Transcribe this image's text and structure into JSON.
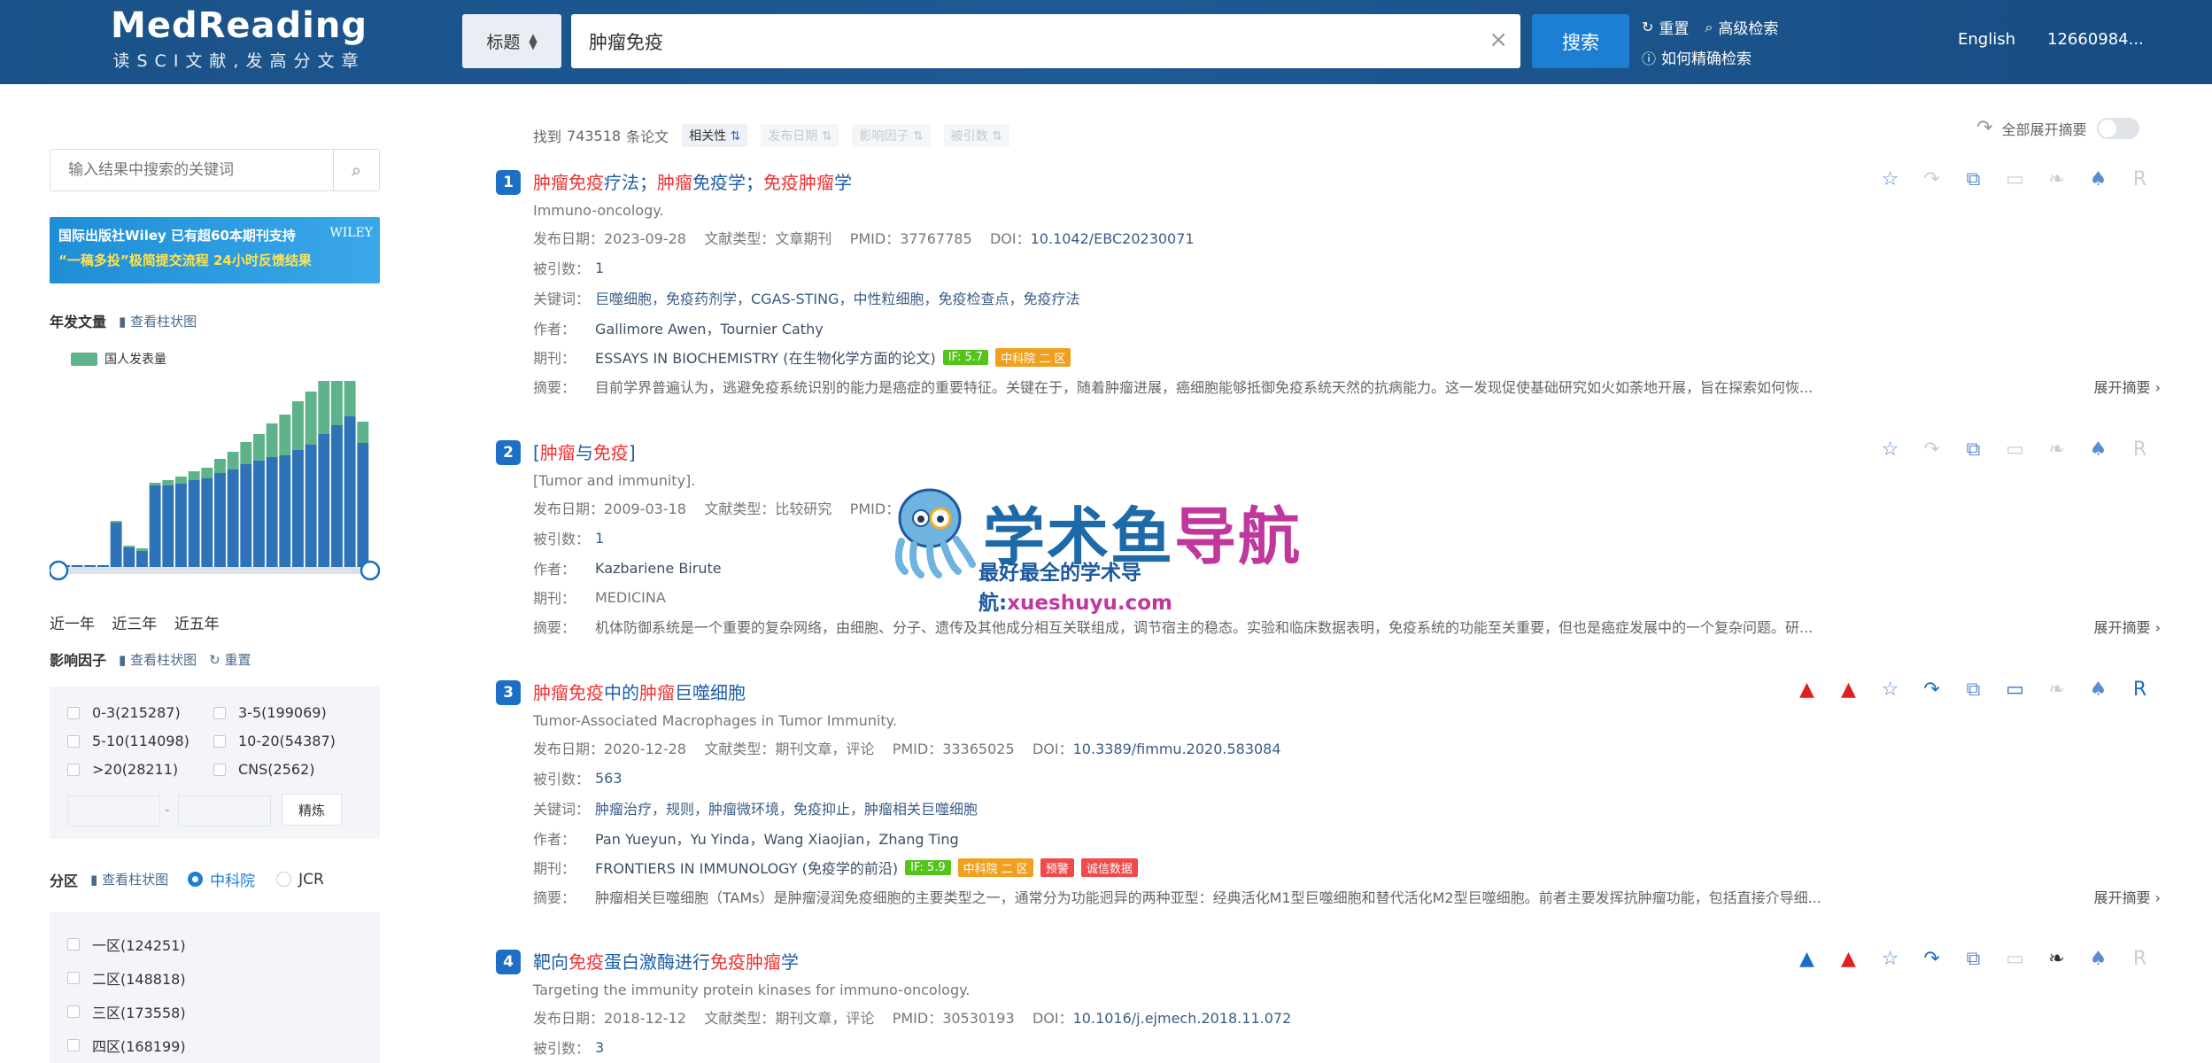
{
  "header": {
    "logo_title": "MedReading",
    "logo_sub": "读SCI文献,发高分文章",
    "field_select": "标题",
    "query": "肿瘤免疫",
    "search_label": "搜索",
    "reset_label": "重置",
    "advanced_label": "高级检索",
    "howto_label": "如何精确检索",
    "lang_label": "English",
    "user_label": "12660984..."
  },
  "sidebar": {
    "search_placeholder": "输入结果中搜索的关键词",
    "banner_line1": "国际出版社Wiley 已有超60本期刊支持",
    "banner_line2": "“一稿多投”极简提交流程 24小时反馈结果",
    "banner_logo": "WILEY",
    "year_title": "年发文量",
    "bar_view_label": "查看柱状图",
    "legend_label": "国人发表量",
    "ranges": [
      "近一年",
      "近三年",
      "近五年"
    ],
    "if_title": "影响因子",
    "if_bar_view": "查看柱状图",
    "if_reset": "重置",
    "if_options": [
      "0-3(215287)",
      "3-5(199069)",
      "5-10(114098)",
      "10-20(54387)",
      ">20(28211)",
      "CNS(2562)"
    ],
    "range_sep": "-",
    "refine_label": "精炼",
    "zone_title": "分区",
    "zone_bar_view": "查看柱状图",
    "zone_radio_cas": "中科院",
    "zone_radio_jcr": "JCR",
    "zone_options": [
      "一区(124251)",
      "二区(148818)",
      "三区(173558)",
      "四区(168199)"
    ],
    "colors": {
      "green": "#5fb38b",
      "blue": "#2e72b8"
    }
  },
  "chart_data": {
    "type": "bar",
    "title": "年发文量",
    "series": [
      {
        "name": "国人发表量",
        "values": [
          0,
          0,
          0,
          0,
          2,
          2,
          3,
          3,
          6,
          8,
          10,
          12,
          16,
          20,
          25,
          30,
          38,
          46,
          55,
          60,
          68,
          75,
          60,
          24
        ]
      },
      {
        "name": "",
        "values": [
          2,
          2,
          2,
          2,
          50,
          22,
          18,
          92,
          92,
          94,
          98,
          100,
          106,
          110,
          116,
          120,
          124,
          126,
          132,
          138,
          150,
          160,
          170,
          140
        ]
      }
    ]
  },
  "results": {
    "found_prefix": "找到",
    "found_count": "743518",
    "found_suffix": "条论文",
    "sort_options": [
      "相关性",
      "发布日期",
      "影响因子",
      "被引数"
    ],
    "expand_all_label": "全部展开摘要",
    "labels": {
      "cited": "被引数：",
      "keywords": "关键词：",
      "authors": "作者：",
      "journal": "期刊：",
      "abstract": "摘要：",
      "expand": "展开摘要"
    },
    "items": [
      {
        "num": "1",
        "title_parts": [
          [
            "肿瘤免疫",
            "hl"
          ],
          [
            "疗法；",
            ""
          ],
          [
            "肿瘤",
            "hl"
          ],
          [
            "免疫",
            ""
          ],
          [
            "学；",
            ""
          ],
          [
            "免疫肿瘤",
            "hl"
          ],
          [
            "学",
            ""
          ]
        ],
        "subtitle": "Immuno-oncology.",
        "date": "发布日期：2023-09-28",
        "type": "文献类型：文章期刊",
        "pmid": "PMID：37767785",
        "doi_label": "DOI：",
        "doi": "10.1042/EBC20230071",
        "cited": "1",
        "keywords": "巨噬细胞，免疫药剂学，CGAS-STING，中性粒细胞，免疫检查点，免疫疗法",
        "authors": "Gallimore Awen，Tournier Cathy",
        "journal": "ESSAYS IN BIOCHEMISTRY (在生物化学方面的论文)",
        "if_tag": "IF: 5.7",
        "zone_tag": "中科院 二 区",
        "abstract": "目前学界普遍认为，逃避免疫系统识别的能力是癌症的重要特征。关键在于，随着肿瘤进展，癌细胞能够抵御免疫系统天然的抗病能力。这一发现促使基础研究如火如荼地开展，旨在探索如何恢..."
      },
      {
        "num": "2",
        "title_parts": [
          [
            "[",
            ""
          ],
          [
            "肿瘤",
            "hl"
          ],
          [
            "与",
            ""
          ],
          [
            "免疫",
            "hl"
          ],
          [
            "]",
            ""
          ]
        ],
        "subtitle": "[Tumor and immunity].",
        "date": "发布日期：2009-03-18",
        "type": "文献类型：比较研究",
        "pmid": "PMID：",
        "cited": "1",
        "authors": "Kazbariene Birute",
        "journal": "MEDICINA",
        "abstract": "机体防御系统是一个重要的复杂网络，由细胞、分子、遗传及其他成分相互关联组成，调节宿主的稳态。实验和临床数据表明，免疫系统的功能至关重要，但也是癌症发展中的一个复杂问题。研..."
      },
      {
        "num": "3",
        "title_parts": [
          [
            "肿瘤免疫",
            "hl"
          ],
          [
            "中的",
            ""
          ],
          [
            "肿瘤",
            "hl"
          ],
          [
            "巨噬细胞",
            ""
          ]
        ],
        "subtitle": "Tumor-Associated Macrophages in Tumor Immunity.",
        "date": "发布日期：2020-12-28",
        "type": "文献类型：期刊文章，评论",
        "pmid": "PMID：33365025",
        "doi_label": "DOI：",
        "doi": "10.3389/fimmu.2020.583084",
        "cited": "563",
        "keywords": "肿瘤治疗，规则，肿瘤微环境，免疫抑止，肿瘤相关巨噬细胞",
        "authors": "Pan Yueyun，Yu Yinda，Wang Xiaojian，Zhang Ting",
        "journal": "FRONTIERS IN IMMUNOLOGY (免疫学的前沿)",
        "if_tag": "IF: 5.9",
        "zone_tag": "中科院 二 区",
        "warn_tag": "预警",
        "integrity_tag": "诚信数据",
        "abstract": "肿瘤相关巨噬细胞（TAMs）是肿瘤浸润免疫细胞的主要类型之一，通常分为功能迥异的两种亚型：经典活化M1型巨噬细胞和替代活化M2型巨噬细胞。前者主要发挥抗肿瘤功能，包括直接介导细..."
      },
      {
        "num": "4",
        "title_parts": [
          [
            "靶向",
            ""
          ],
          [
            "免疫",
            "hl"
          ],
          [
            "蛋白激酶进行",
            ""
          ],
          [
            "免疫肿瘤",
            "hl"
          ],
          [
            "学",
            ""
          ]
        ],
        "subtitle": "Targeting the immunity protein kinases for immuno-oncology.",
        "date": "发布日期：2018-12-12",
        "type": "文献类型：期刊文章，评论",
        "pmid": "PMID：30530193",
        "doi_label": "DOI：",
        "doi": "10.1016/j.ejmech.2018.11.072",
        "cited": "3"
      }
    ]
  },
  "watermark": {
    "main_a": "学术鱼",
    "main_b": "导航",
    "sub_a": "最好最全的学术导航:",
    "sub_b": "xueshuyu.com"
  }
}
